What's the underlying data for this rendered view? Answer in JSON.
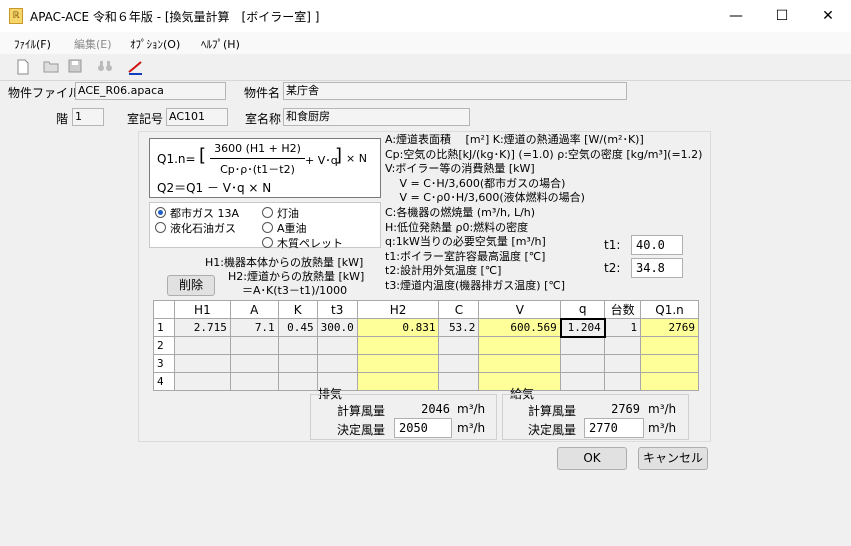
{
  "window": {
    "title": "APAC-ACE 令和６年版 - [換気量計算　[ボイラー室] ]",
    "minimize": "—",
    "maximize": "☐",
    "close": "✕"
  },
  "menu": [
    "ﾌｧｲﾙ(F)",
    "編集(E)",
    "ｵﾌﾟｼｮﾝ(O)",
    "ﾍﾙﾌﾟ(H)"
  ],
  "toolbar": [
    "new-file-icon",
    "open-folder-icon",
    "save-icon",
    "binoculars-icon",
    "chart-icon"
  ],
  "header": {
    "file_label": "物件ファイル名",
    "file_value": "ACE_R06.apaca",
    "name_label": "物件名",
    "name_value": "某庁舎",
    "floor_label": "階",
    "floor_value": "1",
    "room_code_label": "室記号",
    "room_code_value": "AC101",
    "room_name_label": "室名称",
    "room_name_value": "和食厨房"
  },
  "formula": {
    "q1_prefix": "Q1.n=",
    "numer": "3600 (H1 + H2)",
    "denom": "Cp･ρ･(t1－t2)",
    "plus": "+ V･q",
    "times": "× N",
    "q2": "Q2＝Q1 － V･q × N"
  },
  "fuel": {
    "options": [
      "都市ガス 13A",
      "液化石油ガス",
      "灯油",
      "A重油",
      "木質ペレット"
    ],
    "selected": "都市ガス 13A"
  },
  "legend": [
    "A:煙道表面積　 [m²] K:煙道の熱通過率 [W/(m²･K)]",
    "Cp:空気の比熱[kJ/(kg･K)] (=1.0) ρ:空気の密度 [kg/m³](=1.2)",
    " V:ボイラー等の消費熱量 [kW]",
    "　 V = C･H/3,600(都市ガスの場合)",
    "　 V = C･ρ0･H/3,600(液体燃料の場合)",
    "C:各機器の燃焼量 (m³/h, L/h)",
    "H:低位発熱量 ρ0:燃料の密度",
    " q:1kW当りの必要空気量 [m³/h]",
    "t1:ボイラー室許容最高温度 [℃]",
    "t2:設計用外気温度 [℃]",
    "t3:煙道内温度(機器排ガス温度) [℃]"
  ],
  "notes": {
    "h1": "H1:機器本体からの放熱量 [kW]",
    "h2": "H2:煙道からの放熱量 [kW]",
    "h2_eq": "＝A･K(t3－t1)/1000"
  },
  "t1_label": "t1:",
  "t1_value": "40.0",
  "t2_label": "t2:",
  "t2_value": "34.8",
  "delete_label": "削除",
  "table": {
    "headers": [
      "",
      "H1",
      "A",
      "K",
      "t3",
      "H2",
      "C",
      "V",
      "q",
      "台数",
      "Q1.n"
    ],
    "rows": [
      [
        "1",
        "2.715",
        "7.1",
        "0.45",
        "300.0",
        "0.831",
        "53.2",
        "600.569",
        "1.204",
        "1",
        "2769"
      ],
      [
        "2",
        "",
        "",
        "",
        "",
        "",
        "",
        "",
        "",
        "",
        ""
      ],
      [
        "3",
        "",
        "",
        "",
        "",
        "",
        "",
        "",
        "",
        "",
        ""
      ],
      [
        "4",
        "",
        "",
        "",
        "",
        "",
        "",
        "",
        "",
        "",
        ""
      ]
    ]
  },
  "exhaust": {
    "title": "排気",
    "calc_label": "計算風量",
    "calc_value": "2046",
    "unit": "m³/h",
    "decided_label": "決定風量",
    "decided_value": "2050"
  },
  "supply": {
    "title": "給気",
    "calc_label": "計算風量",
    "calc_value": "2769",
    "unit": "m³/h",
    "decided_label": "決定風量",
    "decided_value": "2770"
  },
  "ok_label": "OK",
  "cancel_label": "キャンセル"
}
